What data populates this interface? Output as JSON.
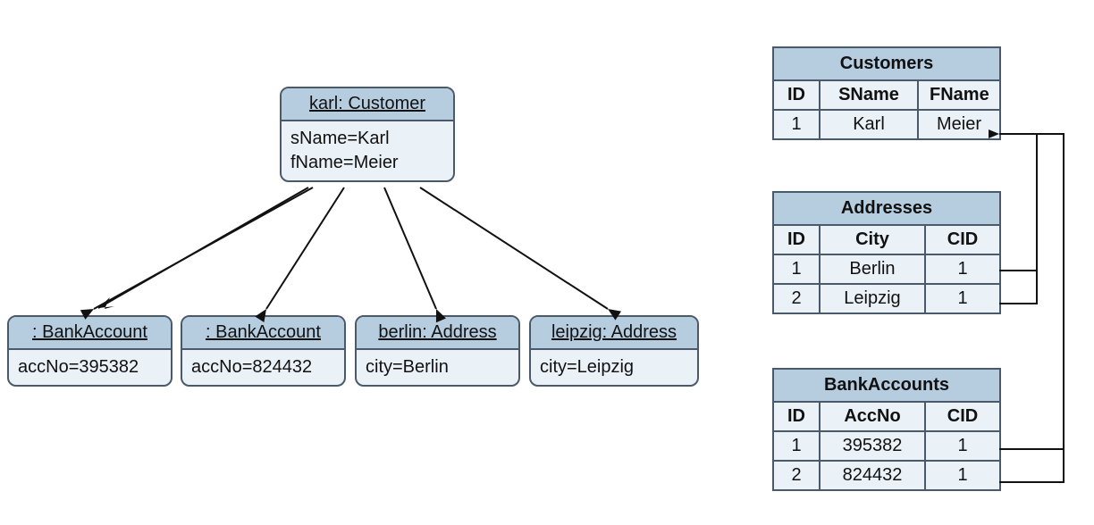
{
  "uml": {
    "customer": {
      "title": "karl: Customer",
      "body": "sName=Karl\nfName=Meier"
    },
    "ba1": {
      "title": ": BankAccount",
      "body": "accNo=395382"
    },
    "ba2": {
      "title": ": BankAccount",
      "body": "accNo=824432"
    },
    "addr1": {
      "title": "berlin: Address",
      "body": "city=Berlin"
    },
    "addr2": {
      "title": "leipzig: Address",
      "body": "city=Leipzig"
    }
  },
  "tables": {
    "customers": {
      "caption": "Customers",
      "headers": [
        "ID",
        "SName",
        "FName"
      ],
      "rows": [
        [
          "1",
          "Karl",
          "Meier"
        ]
      ]
    },
    "addresses": {
      "caption": "Addresses",
      "headers": [
        "ID",
        "City",
        "CID"
      ],
      "rows": [
        [
          "1",
          "Berlin",
          "1"
        ],
        [
          "2",
          "Leipzig",
          "1"
        ]
      ]
    },
    "bankaccounts": {
      "caption": "BankAccounts",
      "headers": [
        "ID",
        "AccNo",
        "CID"
      ],
      "rows": [
        [
          "1",
          "395382",
          "1"
        ],
        [
          "2",
          "824432",
          "1"
        ]
      ]
    }
  }
}
